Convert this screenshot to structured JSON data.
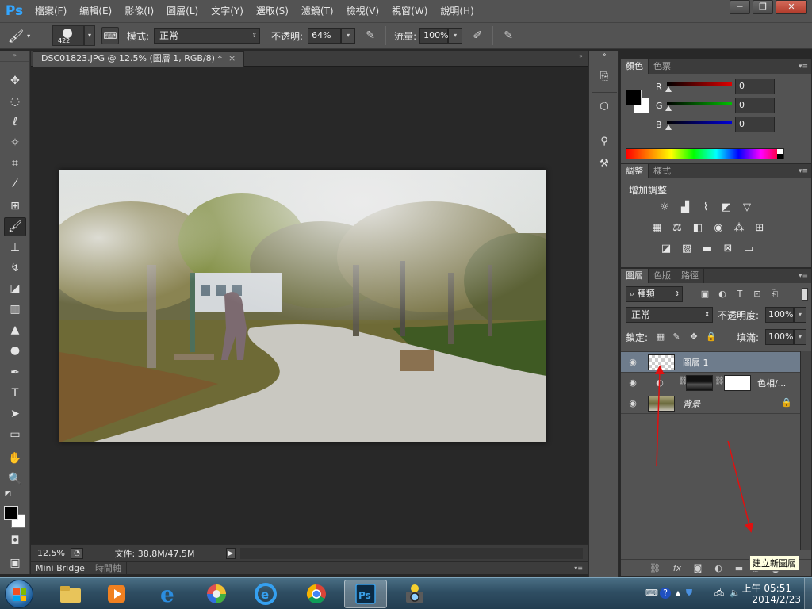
{
  "app": {
    "logo": "Ps"
  },
  "menu": [
    "檔案(F)",
    "編輯(E)",
    "影像(I)",
    "圖層(L)",
    "文字(Y)",
    "選取(S)",
    "濾鏡(T)",
    "檢視(V)",
    "視窗(W)",
    "說明(H)"
  ],
  "window_controls": {
    "minimize": "─",
    "restore": "❐",
    "close": "✕"
  },
  "options": {
    "brush_size": "422",
    "mode_label": "模式:",
    "mode_value": "正常",
    "opacity_label": "不透明:",
    "opacity_value": "64%",
    "flow_label": "流量:",
    "flow_value": "100%"
  },
  "document": {
    "tab_title": "DSC01823.JPG @ 12.5% (圖層 1, RGB/8) *",
    "tab_close": "×",
    "zoom": "12.5%",
    "file_info": "文件: 38.8M/47.5M"
  },
  "bottom_tabs": [
    "Mini Bridge",
    "時間軸"
  ],
  "color_panel": {
    "tabs": [
      "顏色",
      "色票"
    ],
    "sliders": [
      {
        "label": "R",
        "value": "0",
        "color": "#e00000"
      },
      {
        "label": "G",
        "value": "0",
        "color": "#00c000"
      },
      {
        "label": "B",
        "value": "0",
        "color": "#0000d8"
      }
    ],
    "foreground": "#000000",
    "background": "#ffffff"
  },
  "adjust_panel": {
    "tabs": [
      "調整",
      "樣式"
    ],
    "title": "增加調整"
  },
  "layers_panel": {
    "tabs": [
      "圖層",
      "色版",
      "路徑"
    ],
    "filter_kind": "種類",
    "blend_mode": "正常",
    "opacity_label": "不透明度:",
    "opacity_value": "100%",
    "lock_label": "鎖定:",
    "fill_label": "填滿:",
    "fill_value": "100%",
    "layers": [
      {
        "name": "圖層 1",
        "selected": true,
        "type": "transparent"
      },
      {
        "name": "色相/...",
        "selected": false,
        "type": "adjustment"
      },
      {
        "name": "背景",
        "selected": false,
        "type": "background"
      }
    ],
    "tooltip": "建立新圖層"
  },
  "taskbar": {
    "time": "上午 05:51",
    "date": "2014/2/23"
  }
}
